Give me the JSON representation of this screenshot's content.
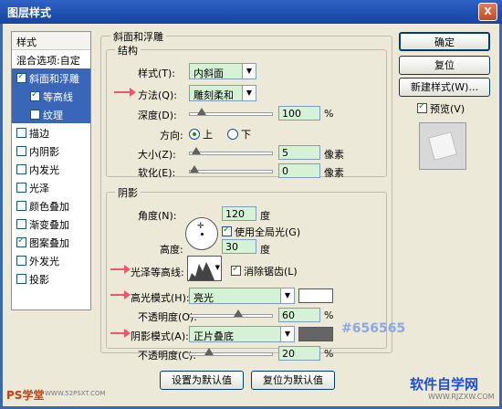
{
  "window": {
    "title": "图层样式",
    "close_glyph": "X"
  },
  "sidebar": {
    "header": "样式",
    "items": [
      {
        "label": "混合选项:自定",
        "checkbox": false,
        "checked": false,
        "selected": false,
        "indent": false
      },
      {
        "label": "斜面和浮雕",
        "checkbox": true,
        "checked": true,
        "selected": true,
        "indent": false
      },
      {
        "label": "等高线",
        "checkbox": true,
        "checked": true,
        "selected": true,
        "indent": true
      },
      {
        "label": "纹理",
        "checkbox": true,
        "checked": false,
        "selected": true,
        "indent": true
      },
      {
        "label": "描边",
        "checkbox": true,
        "checked": false,
        "selected": false,
        "indent": false
      },
      {
        "label": "内阴影",
        "checkbox": true,
        "checked": false,
        "selected": false,
        "indent": false
      },
      {
        "label": "内发光",
        "checkbox": true,
        "checked": false,
        "selected": false,
        "indent": false
      },
      {
        "label": "光泽",
        "checkbox": true,
        "checked": false,
        "selected": false,
        "indent": false
      },
      {
        "label": "颜色叠加",
        "checkbox": true,
        "checked": false,
        "selected": false,
        "indent": false
      },
      {
        "label": "渐变叠加",
        "checkbox": true,
        "checked": false,
        "selected": false,
        "indent": false
      },
      {
        "label": "图案叠加",
        "checkbox": true,
        "checked": true,
        "selected": false,
        "indent": false
      },
      {
        "label": "外发光",
        "checkbox": true,
        "checked": false,
        "selected": false,
        "indent": false
      },
      {
        "label": "投影",
        "checkbox": true,
        "checked": false,
        "selected": false,
        "indent": false
      }
    ]
  },
  "bevel": {
    "group_title": "斜面和浮雕",
    "structure_title": "结构",
    "style_label": "样式(T):",
    "style_value": "内斜面",
    "technique_label": "方法(Q):",
    "technique_value": "雕刻柔和",
    "depth_label": "深度(D):",
    "depth_value": "100",
    "depth_unit": "%",
    "depth_level": 0.1,
    "direction_label": "方向:",
    "direction_up": "上",
    "direction_down": "下",
    "size_label": "大小(Z):",
    "size_value": "5",
    "size_unit": "像素",
    "size_level": 0.02,
    "soften_label": "软化(E):",
    "soften_value": "0",
    "soften_unit": "像素",
    "soften_level": 0.0
  },
  "shading": {
    "title": "阴影",
    "angle_label": "角度(N):",
    "angle_value": "120",
    "angle_unit": "度",
    "global_light_label": "使用全局光(G)",
    "global_light_checked": true,
    "altitude_label": "高度:",
    "altitude_value": "30",
    "altitude_unit": "度",
    "gloss_label": "光泽等高线:",
    "antialias_label": "消除锯齿(L)",
    "antialias_checked": true,
    "highlight_label": "高光模式(H):",
    "highlight_mode": "亮光",
    "highlight_color": "#ffffff",
    "highlight_opacity_label": "不透明度(O):",
    "highlight_opacity": "60",
    "highlight_opacity_unit": "%",
    "highlight_level": 0.6,
    "shadow_label": "阴影模式(A):",
    "shadow_mode": "正片叠底",
    "shadow_color": "#656565",
    "shadow_opacity_label": "不透明度(C):",
    "shadow_opacity": "20",
    "shadow_opacity_unit": "%",
    "shadow_level": 0.2,
    "annotation": "#656565"
  },
  "buttons": {
    "ok": "确定",
    "reset": "复位",
    "new_style": "新建样式(W)...",
    "preview_label": "预览(V)",
    "preview_checked": true,
    "make_default": "设置为默认值",
    "reset_default": "复位为默认值"
  },
  "watermark": {
    "left": "PS学堂",
    "left_url": "WWW.52PSXT.COM",
    "right": "软件自学网",
    "right_url": "WWW.RJZXW.COM"
  }
}
